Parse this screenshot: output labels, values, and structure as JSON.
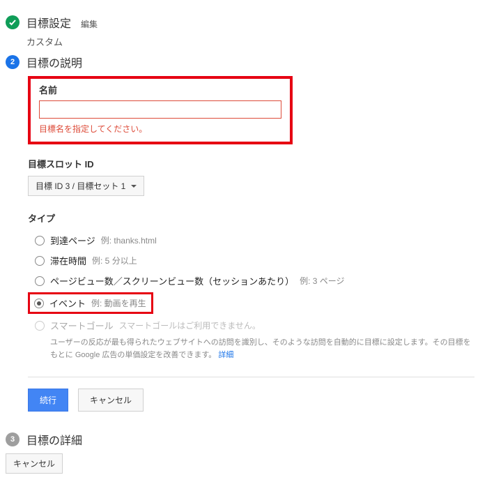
{
  "steps": {
    "setup": {
      "number_done": "✓",
      "title": "目標設定",
      "edit": "編集",
      "sub": "カスタム"
    },
    "desc": {
      "number": "2",
      "title": "目標の説明"
    },
    "details": {
      "number": "3",
      "title": "目標の詳細"
    }
  },
  "name": {
    "label": "名前",
    "value": "",
    "error": "目標名を指定してください。"
  },
  "slot": {
    "label": "目標スロット ID",
    "selected": "目標 ID 3 / 目標セット 1"
  },
  "type": {
    "label": "タイプ",
    "options": {
      "destination": {
        "label": "到達ページ",
        "hint": "例: thanks.html"
      },
      "duration": {
        "label": "滞在時間",
        "hint": "例: 5 分以上"
      },
      "pages": {
        "label": "ページビュー数／スクリーンビュー数（セッションあたり）",
        "hint": "例: 3 ページ"
      },
      "event": {
        "label": "イベント",
        "hint": "例: 動画を再生"
      },
      "smart": {
        "label": "スマートゴール",
        "hint": "スマートゴールはご利用できません。"
      }
    },
    "smart_desc_pre": "ユーザーの反応が最も得られたウェブサイトへの訪問を識別し、そのような訪問を自動的に目標に設定します。その目標をもとに Google 広告の単価設定を改善できます。",
    "smart_desc_link": "詳細"
  },
  "buttons": {
    "continue": "続行",
    "cancel": "キャンセル"
  }
}
